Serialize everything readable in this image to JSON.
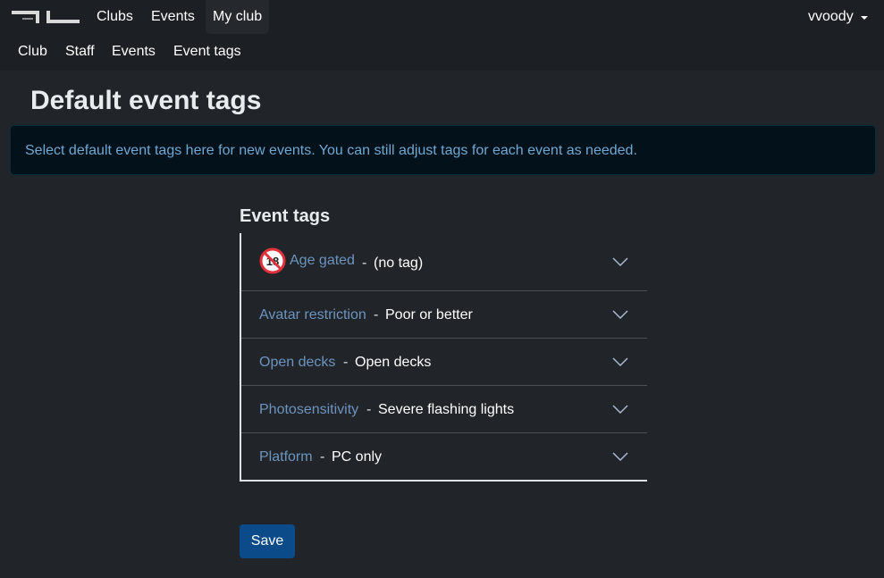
{
  "topnav": {
    "items": [
      {
        "label": "Clubs"
      },
      {
        "label": "Events"
      },
      {
        "label": "My club"
      }
    ],
    "user": "vvoody"
  },
  "subnav": {
    "items": [
      {
        "label": "Club"
      },
      {
        "label": "Staff"
      },
      {
        "label": "Events"
      },
      {
        "label": "Event tags"
      }
    ]
  },
  "page": {
    "title": "Default event tags",
    "info": "Select default event tags here for new events. You can still adjust tags for each event as needed."
  },
  "tags": {
    "title": "Event tags",
    "separator": "-",
    "items": [
      {
        "label": "Age gated",
        "value": "(no tag)",
        "icon": "no-under-18-icon"
      },
      {
        "label": "Avatar restriction",
        "value": "Poor or better"
      },
      {
        "label": "Open decks",
        "value": "Open decks"
      },
      {
        "label": "Photosensitivity",
        "value": "Severe flashing lights"
      },
      {
        "label": "Platform",
        "value": "PC only"
      }
    ]
  },
  "actions": {
    "save_label": "Save"
  },
  "colors": {
    "background": "#212529",
    "navbar": "#1c1f23",
    "link": "#6c94bf",
    "primary_button": "#0b4b8a"
  }
}
